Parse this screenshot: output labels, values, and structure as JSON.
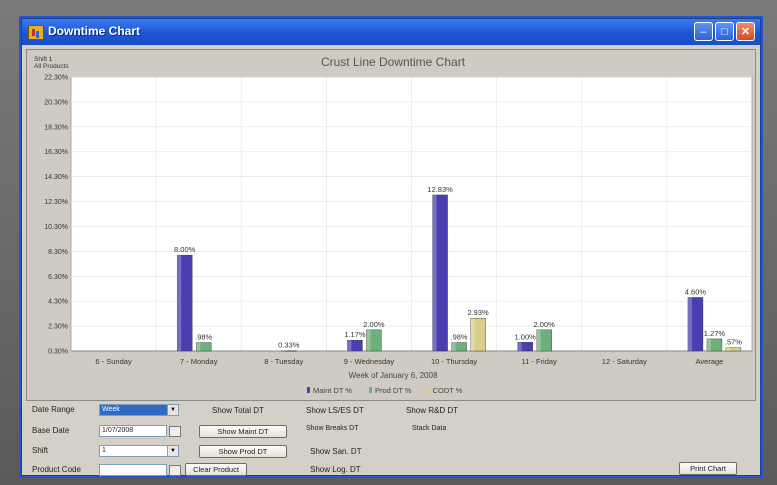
{
  "window": {
    "title": "Downtime Chart"
  },
  "chart_header": {
    "shift": "Shift 1",
    "products": "All Products"
  },
  "chart_data": {
    "type": "bar",
    "title": "Crust Line Downtime Chart",
    "xlabel": "Week of January 6, 2008",
    "categories": [
      "6 - Sunday",
      "7 - Monday",
      "8 - Tuesday",
      "9 - Wednesday",
      "10 - Thursday",
      "11 - Friday",
      "12 - Saturday",
      "Average"
    ],
    "y_ticks": [
      "0.30%",
      "2.30%",
      "4.30%",
      "6.30%",
      "8.30%",
      "10.30%",
      "12.30%",
      "14.30%",
      "16.30%",
      "18.30%",
      "20.30%",
      "22.30%"
    ],
    "ylim": [
      0.3,
      22.3
    ],
    "grid": true,
    "legend_position": "bottom",
    "series": [
      {
        "name": "Maint DT %",
        "color": "#4a3fb0",
        "values": [
          0,
          8.0,
          0,
          1.17,
          12.83,
          1.0,
          0,
          4.6
        ],
        "labels": [
          "",
          "8.00%",
          "",
          "1.17%",
          "12.83%",
          "1.00%",
          "",
          "4.60%"
        ]
      },
      {
        "name": "Prod DT %",
        "color": "#6fb07a",
        "values": [
          0,
          0.98,
          0.33,
          2.0,
          0.98,
          2.0,
          0,
          1.27
        ],
        "labels": [
          "",
          ".98%",
          "0.33%",
          "2.00%",
          ".98%",
          "2.00%",
          "",
          "1.27%"
        ]
      },
      {
        "name": "CODT %",
        "color": "#d8cf8a",
        "values": [
          0,
          0,
          0,
          0,
          2.93,
          0,
          0,
          0.57
        ],
        "labels": [
          "",
          "",
          "",
          "",
          "2.93%",
          "",
          "",
          ".57%"
        ]
      }
    ]
  },
  "controls": {
    "date_range": {
      "label": "Date Range",
      "value": "Week"
    },
    "base_date": {
      "label": "Base Date",
      "value": "1/07/2008"
    },
    "shift": {
      "label": "Shift",
      "value": "1"
    },
    "product_code": {
      "label": "Product Code",
      "value": ""
    },
    "show_total_dt": "Show Total DT",
    "show_maint_dt": "Show Maint DT",
    "show_prod_dt": "Show Prod DT",
    "clear_product": "Clear Product",
    "show_ls_es_dt": "Show LS/ES DT",
    "show_breaks_dt": "Show Breaks DT",
    "show_san_dt": "Show San. DT",
    "show_log_dt": "Show Log. DT",
    "show_rd_dt": "Show R&D DT",
    "stack_data": "Stack Data",
    "print_chart": "Print Chart"
  }
}
